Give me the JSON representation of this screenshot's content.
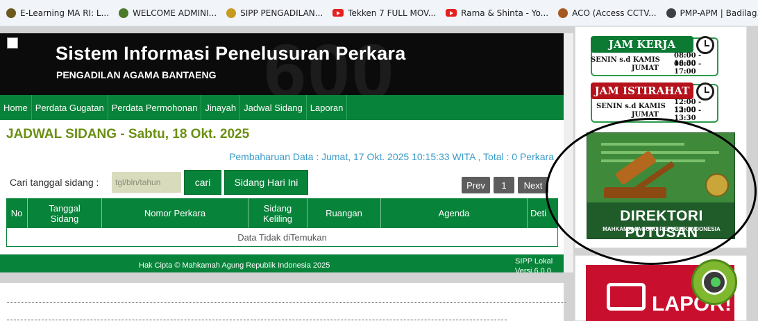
{
  "bookmarks": [
    {
      "label": "E-Learning MA RI: L...",
      "icon": "mahkamah-logo-icon",
      "color": "#6b5a1b"
    },
    {
      "label": "WELCOME ADMINI...",
      "icon": "court-logo-icon",
      "color": "#4a7a2a"
    },
    {
      "label": "SIPP PENGADILAN...",
      "icon": "badge-icon",
      "color": "#c79a1f"
    },
    {
      "label": "Tekken 7 FULL MOV...",
      "icon": "youtube-icon",
      "color": "#e61f1f"
    },
    {
      "label": "Rama & Shinta - Yo...",
      "icon": "youtube-icon",
      "color": "#e61f1f"
    },
    {
      "label": "ACO (Access CCTV...",
      "icon": "cctv-icon",
      "color": "#a5581f"
    },
    {
      "label": "PMP-APM | Badilag...",
      "icon": "globe-icon",
      "color": "#3c4043"
    }
  ],
  "header": {
    "title": "Sistem Informasi Penelusuran Perkara",
    "subtitle": "PENGADILAN AGAMA BANTAENG",
    "background_text": "600"
  },
  "nav": [
    "Home",
    "Perdata Gugatan",
    "Perdata Permohonan",
    "Jinayah",
    "Jadwal Sidang",
    "Laporan"
  ],
  "content": {
    "title": "JADWAL SIDANG - Sabtu, 18 Okt. 2025",
    "update_text": "Pembaharuan Data : Jumat, 17 Okt. 2025 10:15:33 WITA , Total : 0 Perkara",
    "search_label": "Cari tanggal sidang :",
    "search_placeholder": "tgl/bln/tahun",
    "search_button": "cari",
    "today_button": "Sidang Hari Ini",
    "prev_label": "Prev",
    "page_number": "1",
    "next_label": "Next"
  },
  "table": {
    "headers": [
      "No",
      "Tanggal Sidang",
      "Nomor Perkara",
      "Sidang Keliling",
      "Ruangan",
      "Agenda",
      "Deti"
    ],
    "empty_text": "Data Tidak diTemukan"
  },
  "footer": {
    "copyright": "Hak Cipta © Mahkamah Agung Republik Indonesia 2025",
    "version_line1": "SIPP Lokal",
    "version_line2": "Versi 6.0.0"
  },
  "sidebar": {
    "jam_kerja": {
      "title": "JAM KERJA",
      "color": "#0d7a34",
      "rows": [
        {
          "day": "SENIN s.d KAMIS",
          "time": "08:00 - 16:30"
        },
        {
          "day": "JUMAT",
          "time": "08:00 - 17:00"
        }
      ]
    },
    "jam_istirahat": {
      "title": "JAM ISTIRAHAT",
      "color": "#b5121b",
      "rows": [
        {
          "day": "SENIN s.d KAMIS",
          "time": "12:00 - 13:00"
        },
        {
          "day": "JUMAT",
          "time": "12:00 - 13:30"
        }
      ]
    },
    "direktori": {
      "title": "DIREKTORI PUTUSAN",
      "subtitle": "MAHKAMAH AGUNG REPUBLIK INDONESIA"
    },
    "lapor": {
      "title": "LAPOR!"
    }
  },
  "colors": {
    "primary_green": "#08833a",
    "title_olive": "#6b8f12",
    "link_blue": "#3a9bc8",
    "header_black": "#0b0b0b"
  }
}
